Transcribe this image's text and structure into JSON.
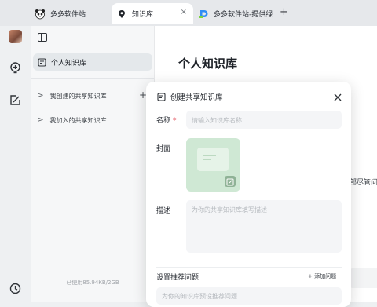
{
  "tabs": [
    {
      "title": "多多软件站",
      "icon": "panda-icon"
    },
    {
      "title": "知识库",
      "icon": "lightbulb-pin-icon",
      "active": true,
      "close": "×"
    },
    {
      "title": "多多软件站-提供绿",
      "icon": "d-logo-icon"
    }
  ],
  "new_tab": "+",
  "rail": {
    "icons": [
      "avatar",
      "lightbulb-add-icon",
      "edit-board-icon",
      "history-clock-icon"
    ]
  },
  "sidebar": {
    "personal": "个人知识库",
    "groups": [
      {
        "label": "我创建的共享知识库",
        "chevron": ">"
      },
      {
        "label": "我加入的共享知识库",
        "chevron": ">"
      }
    ],
    "add": "+",
    "storage": "已使用85.94KB/2GB"
  },
  "main": {
    "title": "个人知识库",
    "peek_text": "部尽管问"
  },
  "modal": {
    "title": "创建共享知识库",
    "name_label": "名称",
    "required_mark": "*",
    "name_placeholder": "请输入知识库名称",
    "cover_label": "封面",
    "desc_label": "描述",
    "desc_placeholder": "为你的共享知识库填写描述",
    "faq_label": "设置推荐问题",
    "faq_add": "+ 添加问题",
    "faq_placeholder": "为你的知识库预设推荐问题"
  },
  "colors": {
    "accent": "#e34d59",
    "cover_bg": "#cfe8d4",
    "cover_edit": "#8fb296"
  }
}
